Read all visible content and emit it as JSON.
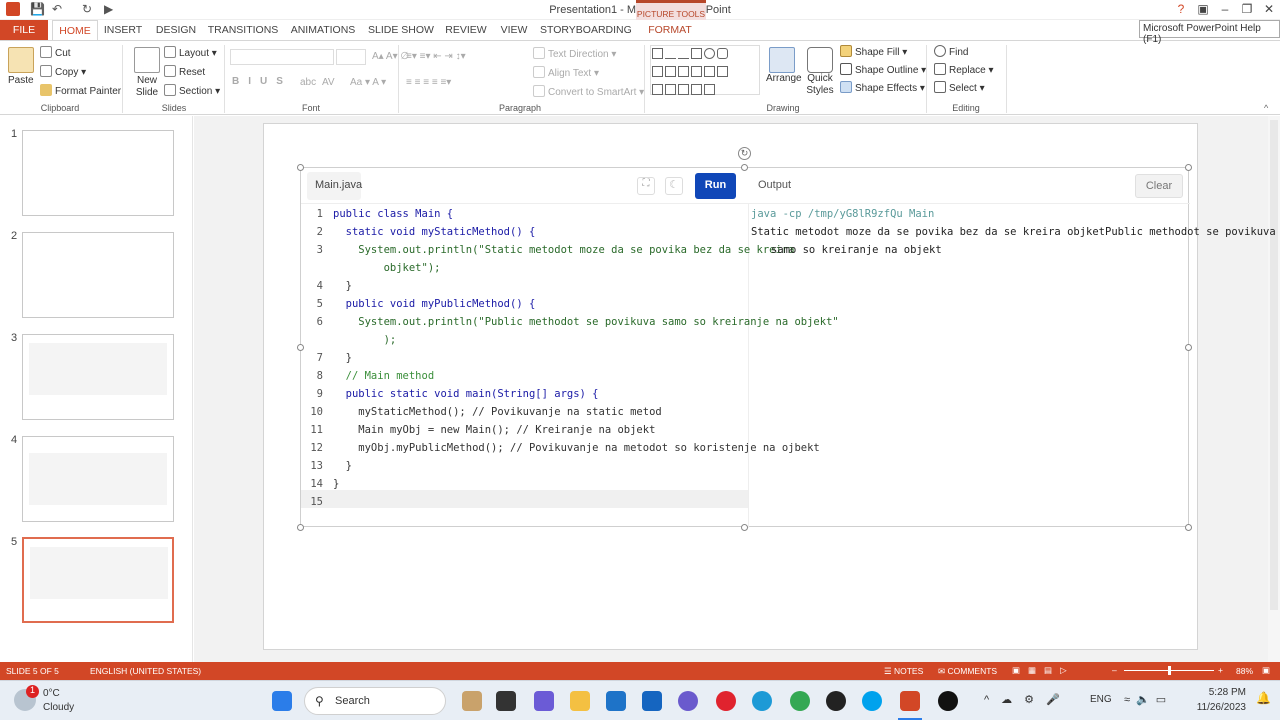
{
  "window": {
    "title": "Presentation1 - Microsoft PowerPoint",
    "context_tab": "PICTURE TOOLS",
    "tooltip": "Microsoft PowerPoint Help (F1)",
    "help_icon": "?"
  },
  "tabs": [
    "FILE",
    "HOME",
    "INSERT",
    "DESIGN",
    "TRANSITIONS",
    "ANIMATIONS",
    "SLIDE SHOW",
    "REVIEW",
    "VIEW",
    "STORYBOARDING",
    "FORMAT"
  ],
  "ribbon": {
    "clipboard": {
      "paste": "Paste",
      "cut": "Cut",
      "copy": "Copy",
      "format_painter": "Format Painter",
      "label": "Clipboard"
    },
    "slides": {
      "new_slide": "New Slide",
      "layout": "Layout",
      "reset": "Reset",
      "section": "Section",
      "label": "Slides"
    },
    "font": {
      "label": "Font",
      "bold": "B",
      "italic": "I",
      "underline": "U",
      "strike": "S",
      "abc": "abc",
      "av": "AV"
    },
    "paragraph": {
      "label": "Paragraph",
      "text_direction": "Text Direction",
      "align_text": "Align Text",
      "convert": "Convert to SmartArt"
    },
    "drawing": {
      "label": "Drawing",
      "arrange": "Arrange",
      "quick_styles": "Quick Styles",
      "shape_fill": "Shape Fill",
      "shape_outline": "Shape Outline",
      "shape_effects": "Shape Effects"
    },
    "editing": {
      "label": "Editing",
      "find": "Find",
      "replace": "Replace",
      "select": "Select"
    }
  },
  "thumbnails": [
    "1",
    "2",
    "3",
    "4",
    "5"
  ],
  "editor": {
    "filename": "Main.java",
    "run": "Run",
    "output_label": "Output",
    "clear": "Clear",
    "lines": [
      {
        "n": "1",
        "code": "public class Main {"
      },
      {
        "n": "2",
        "code": "  static void myStaticMethod() {"
      },
      {
        "n": "3",
        "code": "    System.out.println(\"Static metodot moze da se povika bez da se kreira"
      },
      {
        "n": "",
        "code": "        objket\");"
      },
      {
        "n": "4",
        "code": "  }"
      },
      {
        "n": "5",
        "code": "  public void myPublicMethod() {"
      },
      {
        "n": "6",
        "code": "    System.out.println(\"Public methodot se povikuva samo so kreiranje na objekt\""
      },
      {
        "n": "",
        "code": "        );"
      },
      {
        "n": "7",
        "code": "  }"
      },
      {
        "n": "8",
        "code": "  // Main method"
      },
      {
        "n": "9",
        "code": "  public static void main(String[] args) {"
      },
      {
        "n": "10",
        "code": "    myStaticMethod(); // Povikuvanje na static metod"
      },
      {
        "n": "11",
        "code": "    Main myObj = new Main(); // Kreiranje na objekt"
      },
      {
        "n": "12",
        "code": "    myObj.myPublicMethod(); // Povikuvanje na metodot so koristenje na ojbekt"
      },
      {
        "n": "13",
        "code": "  }"
      },
      {
        "n": "14",
        "code": "}"
      },
      {
        "n": "15",
        "code": ""
      }
    ],
    "output_cmd": "java -cp /tmp/yG8lR9zfQu Main",
    "output_line1": "Static metodot moze da se povika bez da se kreira objketPublic methodot se povikuva",
    "output_line2": "samo so kreiranje na objekt"
  },
  "status": {
    "slide": "SLIDE 5 OF 5",
    "language": "ENGLISH (UNITED STATES)",
    "notes": "NOTES",
    "comments": "COMMENTS",
    "zoom": "88%"
  },
  "taskbar": {
    "temp": "0°C",
    "weather": "Cloudy",
    "badge": "1",
    "search": "Search",
    "lang": "ENG",
    "time": "5:28 PM",
    "date": "11/26/2023"
  }
}
